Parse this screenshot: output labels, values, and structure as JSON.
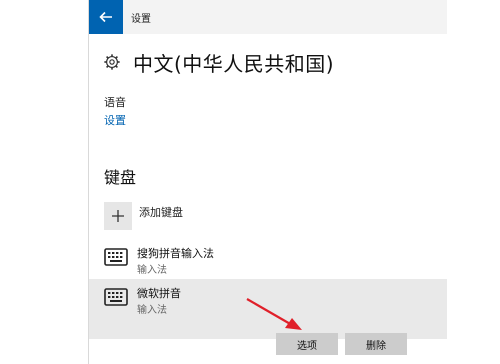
{
  "window": {
    "app_title": "设置"
  },
  "header": {
    "title": "中文(中华人民共和国)"
  },
  "speech": {
    "label": "语音",
    "settings_link": "设置"
  },
  "keyboard": {
    "section_title": "键盘",
    "add_label": "添加键盘",
    "items": [
      {
        "name": "搜狗拼音输入法",
        "type": "输入法"
      },
      {
        "name": "微软拼音",
        "type": "输入法"
      }
    ],
    "options_button": "选项",
    "delete_button": "删除"
  },
  "colors": {
    "accent": "#0063b1",
    "selected_bg": "#e9e9e9",
    "button_bg": "#cccccc",
    "annotation_arrow": "#e0202a"
  }
}
